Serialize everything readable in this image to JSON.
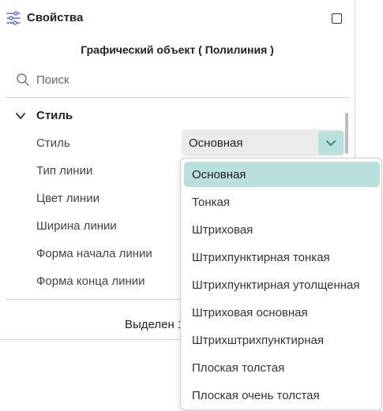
{
  "header": {
    "title": "Свойства"
  },
  "object_title": "Графический объект ( Полилиния )",
  "search": {
    "placeholder": "Поиск"
  },
  "group": {
    "label": "Стиль"
  },
  "properties": [
    {
      "label": "Стиль"
    },
    {
      "label": "Тип линии"
    },
    {
      "label": "Цвет линии"
    },
    {
      "label": "Ширина линии"
    },
    {
      "label": "Форма начала линии"
    },
    {
      "label": "Форма конца линии"
    }
  ],
  "style_select": {
    "value": "Основная",
    "options": [
      "Основная",
      "Тонкая",
      "Штриховая",
      "Штрихпунктирная тонкая",
      "Штрихпунктирная утолщенная",
      "Штриховая основная",
      "Штрихштрихпунктирная",
      "Плоская толстая",
      "Плоская очень толстая"
    ],
    "selected_index": 0
  },
  "footer": {
    "text": "Выделен 1"
  },
  "colors": {
    "accent": "#b9e0dc",
    "accent_icon": "#2e7d74"
  }
}
